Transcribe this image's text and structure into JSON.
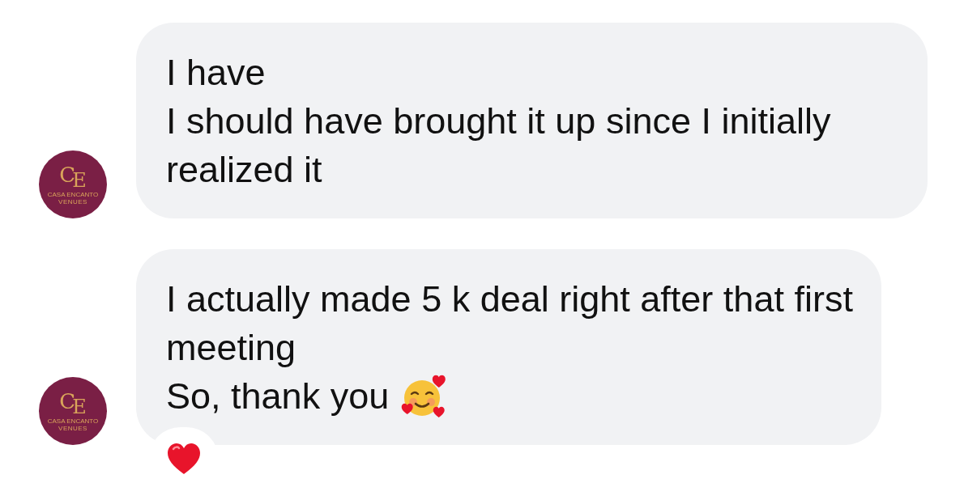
{
  "messages": [
    {
      "avatar": {
        "monogram_1": "C",
        "monogram_2": "E",
        "name": "CASA ENCANTO",
        "tagline": "VENUES"
      },
      "lines": [
        "I have",
        "I should have brought it up since I initially realized it"
      ]
    },
    {
      "avatar": {
        "monogram_1": "C",
        "monogram_2": "E",
        "name": "CASA ENCANTO",
        "tagline": "VENUES"
      },
      "lines": [
        "I actually made 5 k deal right after that first meeting",
        "So, thank you"
      ],
      "emoji": {
        "kind": "smiling-hearts"
      },
      "reaction": {
        "kind": "heart"
      }
    }
  ]
}
